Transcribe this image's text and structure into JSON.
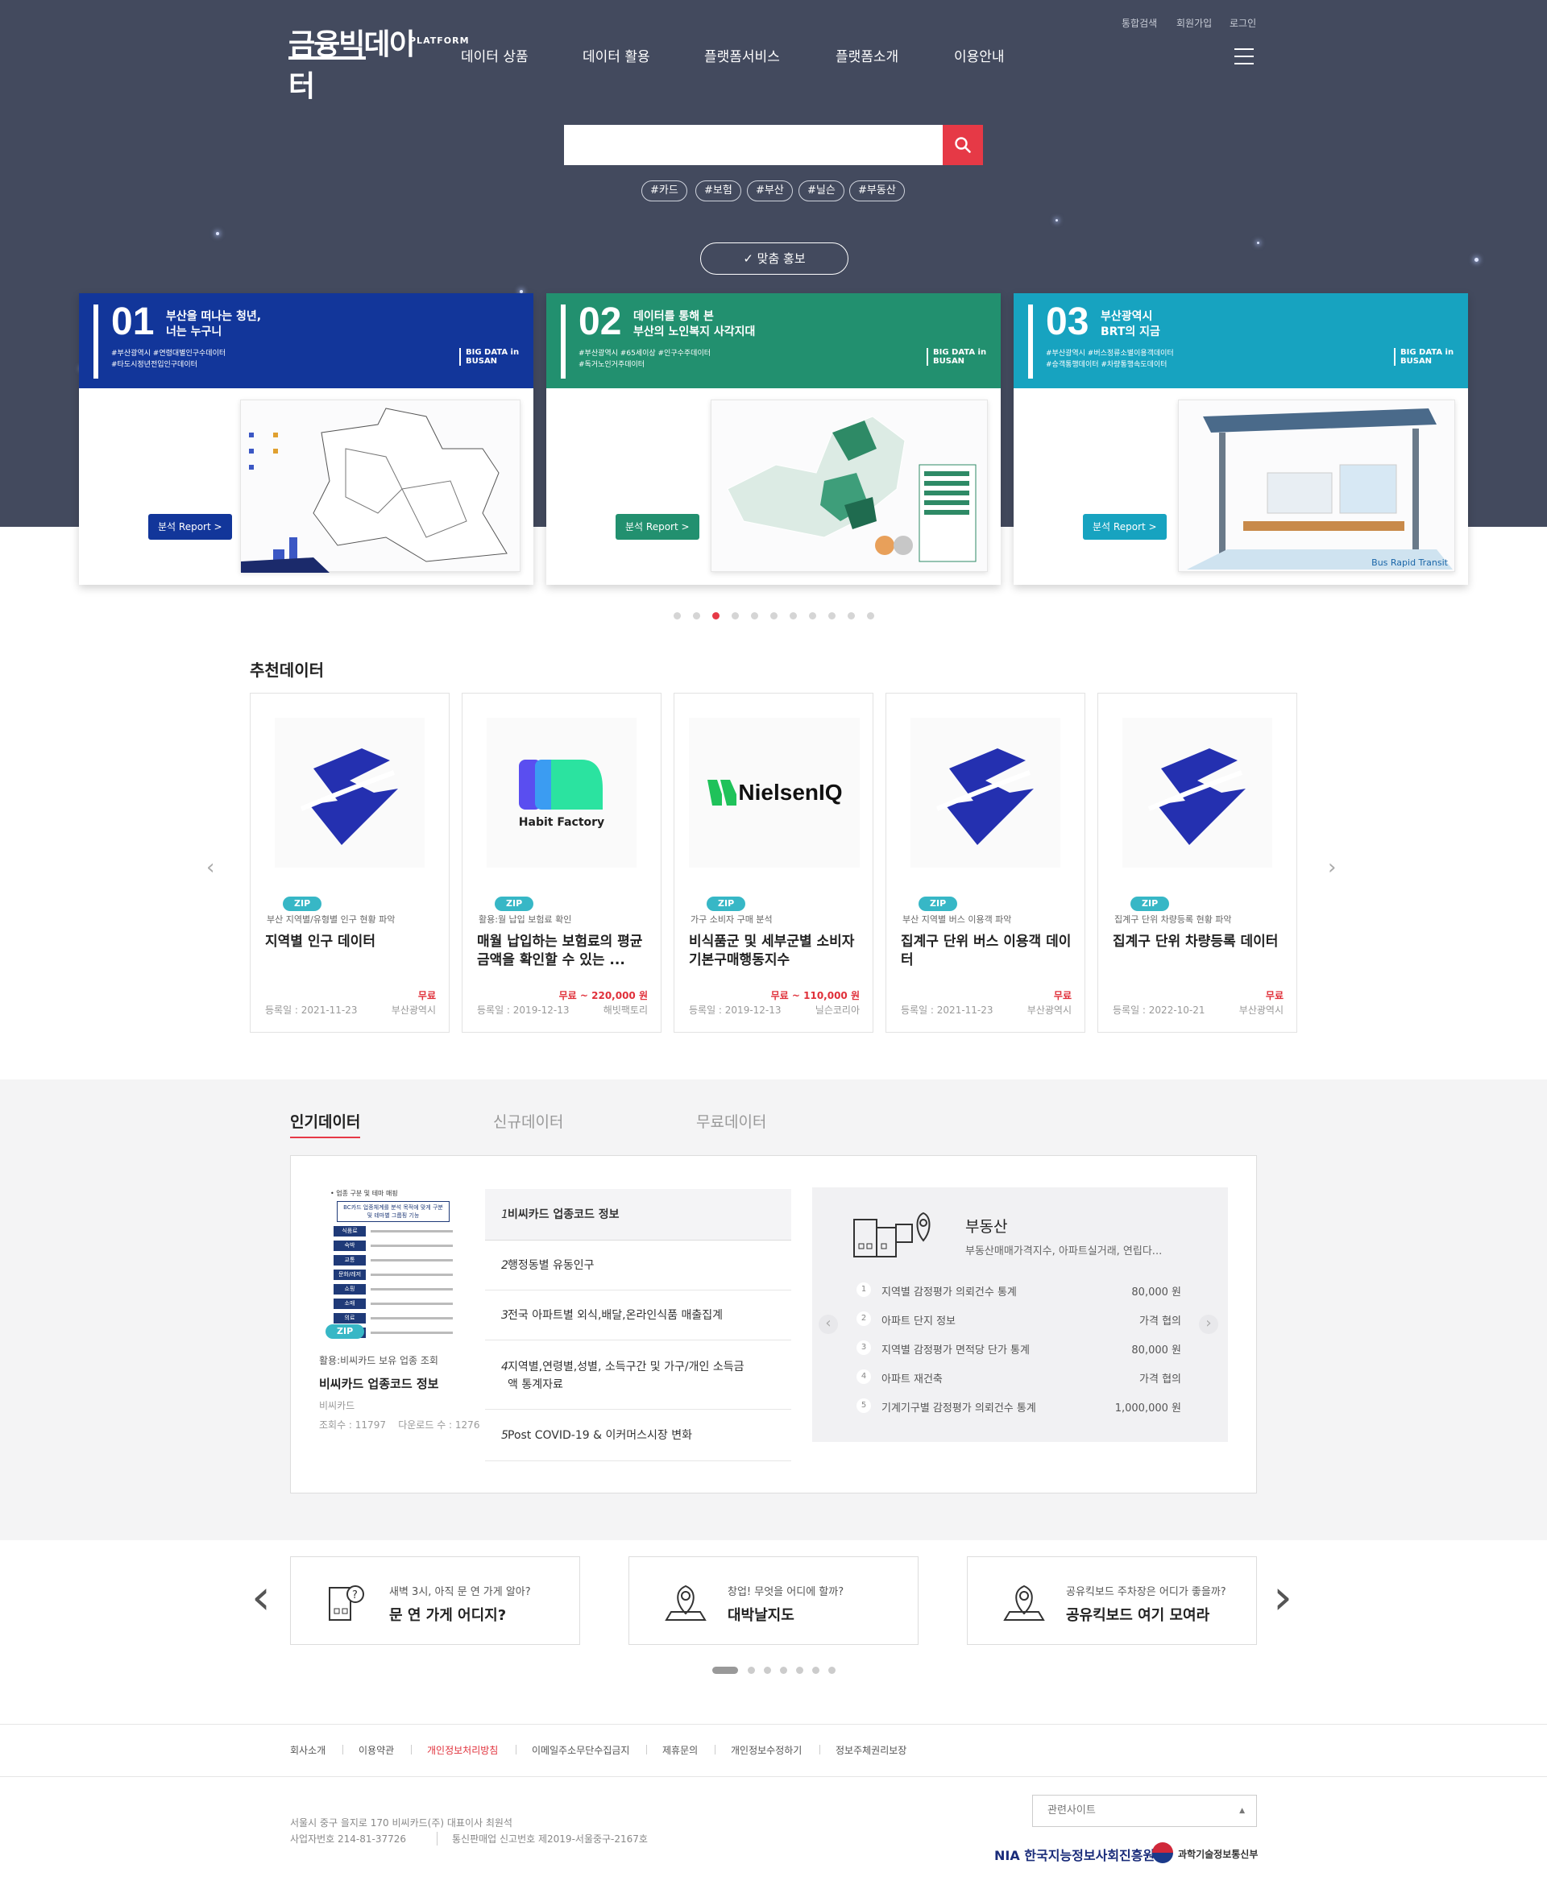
{
  "header": {
    "logo_text": "금융빅데이터",
    "logo_sub": "PLATFORM",
    "nav": [
      "데이터 상품",
      "데이터 활용",
      "플랫폼서비스",
      "플랫폼소개",
      "이용안내"
    ],
    "util": [
      "통합검색",
      "회원가입",
      "로그인"
    ]
  },
  "search": {
    "placeholder": "",
    "tags": [
      "#카드",
      "#보험",
      "#부산",
      "#닐슨",
      "#부동산"
    ]
  },
  "promo_label": "✓  맞춤 홍보",
  "banners": [
    {
      "num": "01",
      "title": "부산을 떠나는 청년,\n너는 누구니",
      "tags": "#부산광역시  #연령대별인구수데이터\n#타도시정년전입인구데이터",
      "big": "BIG DATA in BUSAN",
      "btn": "분석  Report >",
      "color": "#12369a",
      "btncolor": "#12369a"
    },
    {
      "num": "02",
      "title": "데이터를 통해 본\n부산의 노인복지 사각지대",
      "tags": "#부산광역시  #65세이상  #인구수주데이터\n#독거노인거주데이터",
      "big": "BIG DATA in BUSAN",
      "btn": "분석  Report >",
      "color": "#22906f",
      "btncolor": "#22906f"
    },
    {
      "num": "03",
      "title": "부산광역시\nBRT의 지금",
      "tags": "#부산광역시  #버스정류소별이용객데이터\n#승객통행데이터  #차량통행속도데이터",
      "big": "BIG DATA in BUSAN",
      "btn": "분석  Report >",
      "color": "#17a3c0",
      "btncolor": "#17a3c0",
      "img_text": "Bus Rapid Transit"
    }
  ],
  "recommend": {
    "title": "추천데이터",
    "items": [
      {
        "badge": "ZIP",
        "sub": "부산 지역별/유형별 인구 현황 파악",
        "name": "지역별 인구 데이터",
        "price": "무료",
        "date": "등록일 : 2021-11-23",
        "org": "부산광역시",
        "logo": "busan"
      },
      {
        "badge": "ZIP",
        "sub": "활용:월 납입 보험료 확인",
        "name": "매월 납입하는 보험료의 평균 금액을 확인할 수 있는 ...",
        "price": "무료 ~ 220,000 원",
        "date": "등록일 : 2019-12-13",
        "org": "해빗팩토리",
        "logo": "habit",
        "logo_text": "Habit Factory"
      },
      {
        "badge": "ZIP",
        "sub": "가구 소비자 구매 분석",
        "name": "비식품군 및 세부군별 소비자 기본구매행동지수",
        "price": "무료 ~ 110,000 원",
        "date": "등록일 : 2019-12-13",
        "org": "닐슨코리아",
        "logo": "nielsen",
        "logo_text": "NielsenIQ"
      },
      {
        "badge": "ZIP",
        "sub": "부산 지역별 버스 이용객 파악",
        "name": "집계구 단위 버스 이용객 데이터",
        "price": "무료",
        "date": "등록일 : 2021-11-23",
        "org": "부산광역시",
        "logo": "busan"
      },
      {
        "badge": "ZIP",
        "sub": "집계구 단위 차량등록 현황 파악",
        "name": "집계구 단위 차량등록 데이터",
        "price": "무료",
        "date": "등록일 : 2022-10-21",
        "org": "부산광역시",
        "logo": "busan"
      }
    ]
  },
  "popular": {
    "tabs": [
      "인기데이터",
      "신규데이터",
      "무료데이터"
    ],
    "featured": {
      "badge": "ZIP",
      "sub": "활용:비씨카드 보유 업종 조회",
      "name": "비씨카드 업종코드 정보",
      "org": "비씨카드",
      "stats": "조회수 : 11797    다운로드 수 : 1276",
      "doc_title": "• 업종 구분 및 테마 매핑",
      "doc_box": "BC카드 업종체계를 분석 목적에 맞게 구분\n및 테마별 그룹핑 기능",
      "doc_rows": [
        "식품료",
        "숙박",
        "교통",
        "문화/레저",
        "쇼핑",
        "소매",
        "의료",
        "주유"
      ]
    },
    "ranks": [
      {
        "n": "1",
        "t": "비씨카드 업종코드 정보"
      },
      {
        "n": "2",
        "t": "행정동별 유동인구"
      },
      {
        "n": "3",
        "t": "전국 아파트별 외식,배달,온라인식품 매출집계"
      },
      {
        "n": "4",
        "t": "지역별,연령별,성별, 소득구간 및 가구/개인 소득금\n액 통계자료"
      },
      {
        "n": "5",
        "t": "Post COVID-19 & 이커머스시장 변화"
      }
    ],
    "category": {
      "title": "부동산",
      "desc": "부동산매매가격지수, 아파트실거래, 연립다...",
      "items": [
        {
          "n": "1",
          "t": "지역별 감정평가 의뢰건수 통계",
          "v": "80,000 원"
        },
        {
          "n": "2",
          "t": "아파트 단지 정보",
          "v": "가격 협의"
        },
        {
          "n": "3",
          "t": "지역별 감정평가 면적당 단가 통계",
          "v": "80,000 원"
        },
        {
          "n": "4",
          "t": "아파트 재건축",
          "v": "가격 협의"
        },
        {
          "n": "5",
          "t": "기계기구별 감정평가 의뢰건수 통계",
          "v": "1,000,000 원"
        }
      ]
    }
  },
  "shortcuts": [
    {
      "q": "새벽 3시, 아직 문 연 가게 알아?",
      "a": "문 연 가게 어디지?"
    },
    {
      "q": "창업! 무엇을 어디에 할까?",
      "a": "대박날지도"
    },
    {
      "q": "공유킥보드 주차장은 어디가 좋을까?",
      "a": "공유킥보드 여기 모여라"
    }
  ],
  "footer": {
    "links": [
      "회사소개",
      "이용약관",
      "개인정보처리방침",
      "이메일주소무단수집금지",
      "제휴문의",
      "개인정보수정하기",
      "정보주체권리보장"
    ],
    "addr": "서울시 중구 을지로 170 비씨카드(주) 대표이사 최원석",
    "biz": "사업자번호 214-81-37726",
    "tel": "통신판매업 신고번호 제2019-서울중구-2167호",
    "related": "관련사이트",
    "nia": "NIA 한국지능정보사회진흥원",
    "msit": "과학기술정보통신부"
  },
  "colors": {
    "hero": "#434a5e",
    "accent": "#e63946",
    "zip": "#37b7c6"
  }
}
